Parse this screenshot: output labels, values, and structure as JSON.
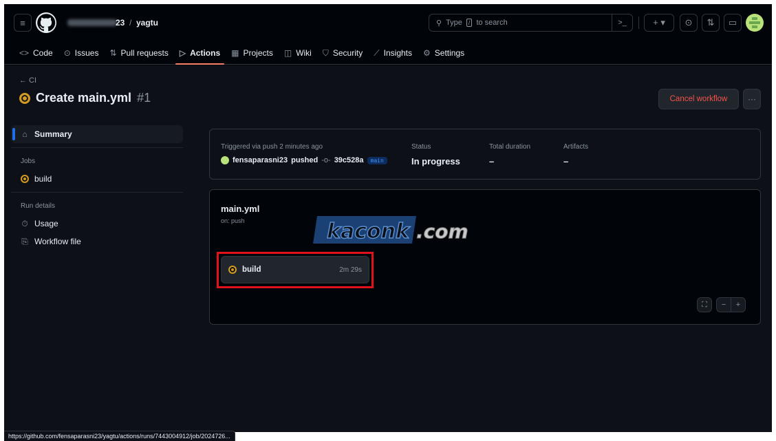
{
  "header": {
    "owner_suffix": "23",
    "slash": "/",
    "repo": "yagtu",
    "search_placeholder": "Type / to search",
    "search_prefix": "Type",
    "search_key": "/",
    "search_suffix": "to search",
    "command_glyph": ">_",
    "plus_glyph": "+ ▾"
  },
  "tabs": [
    {
      "icon": "code-icon",
      "glyph": "<>",
      "label": "Code"
    },
    {
      "icon": "issue-icon",
      "glyph": "⊙",
      "label": "Issues"
    },
    {
      "icon": "pull-request-icon",
      "glyph": "⇅",
      "label": "Pull requests"
    },
    {
      "icon": "play-icon",
      "glyph": "▷",
      "label": "Actions"
    },
    {
      "icon": "table-icon",
      "glyph": "▦",
      "label": "Projects"
    },
    {
      "icon": "book-icon",
      "glyph": "◫",
      "label": "Wiki"
    },
    {
      "icon": "shield-icon",
      "glyph": "⛉",
      "label": "Security"
    },
    {
      "icon": "graph-icon",
      "glyph": "⟋",
      "label": "Insights"
    },
    {
      "icon": "gear-icon",
      "glyph": "⚙",
      "label": "Settings"
    }
  ],
  "active_tab": "Actions",
  "run": {
    "back_label": "← CI",
    "title": "Create main.yml",
    "number": "#1",
    "cancel_label": "Cancel workflow",
    "more_label": "···"
  },
  "sidebar": {
    "summary": "Summary",
    "jobs_heading": "Jobs",
    "job": "build",
    "run_details_heading": "Run details",
    "usage": "Usage",
    "workflow_file": "Workflow file"
  },
  "summary": {
    "trigger_label": "Triggered via push 2 minutes ago",
    "actor": "fensaparasni23",
    "action": "pushed",
    "commit": "39c528a",
    "branch": "main",
    "status_label": "Status",
    "status_value": "In progress",
    "duration_label": "Total duration",
    "duration_value": "–",
    "artifacts_label": "Artifacts",
    "artifacts_value": "–"
  },
  "workflow": {
    "name": "main.yml",
    "trigger": "on: push",
    "job_name": "build",
    "job_time": "2m 29s",
    "watermark": "kaconk.com"
  },
  "statusbar": {
    "url": "https://github.com/fensaparasni23/yagtu/actions/runs/7443004912/job/2024726..."
  },
  "colors": {
    "accent_active_tab": "#f78166",
    "in_progress": "#d29922",
    "danger": "#f85149",
    "highlight_box": "#e3111c",
    "link_blue": "#1f6feb"
  }
}
